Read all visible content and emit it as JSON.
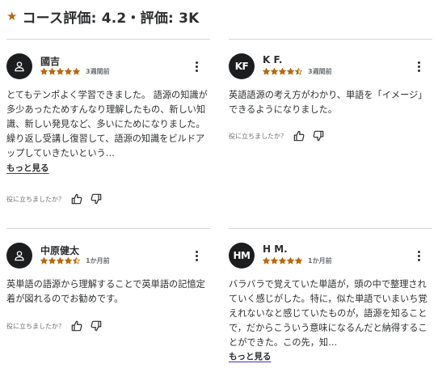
{
  "header": {
    "title": "コース評価: 4.2・評価: 3K",
    "star_color": "#b4690e"
  },
  "reviews": [
    {
      "name": "國吉",
      "initials": "",
      "avatar_icon": "user-icon",
      "rating": 5,
      "date": "3週間前",
      "text": "とてもテンポよく学習できました。 語源の知識が多少あったためすんなり理解したもの、新しい知識、新しい発見など、多いにためになりました。繰り返し受講し復習して、語源の知識をビルドアップしていきたいという…",
      "show_more": "もっと見る",
      "helpful_question": "役に立ちましたか？"
    },
    {
      "name": "K F.",
      "initials": "KF",
      "avatar_icon": "",
      "rating": 4.5,
      "date": "3週間前",
      "text": "英語語源の考え方がわかり、単語を「イメージ」できるようになりました。",
      "show_more": "",
      "helpful_question": "役に立ちましたか？"
    },
    {
      "name": "中原健太",
      "initials": "",
      "avatar_icon": "user-icon",
      "rating": 4.5,
      "date": "1か月前",
      "text": "英単語の語源から理解することで英単語の記憶定着が図れるのでお勧めです。",
      "show_more": "",
      "helpful_question": "役に立ちましたか？"
    },
    {
      "name": "H M.",
      "initials": "HM",
      "avatar_icon": "",
      "rating": 5,
      "date": "1か月前",
      "text": "バラバラで覚えていた単語が，頭の中で整理されていく感じがした。特に，似た単語でいまいち覚えれないなと感じていたものが，語源を知ることで，だからこういう意味になるんだと納得することができた。この先，知…",
      "show_more": "もっと見る",
      "helpful_question": ""
    }
  ]
}
